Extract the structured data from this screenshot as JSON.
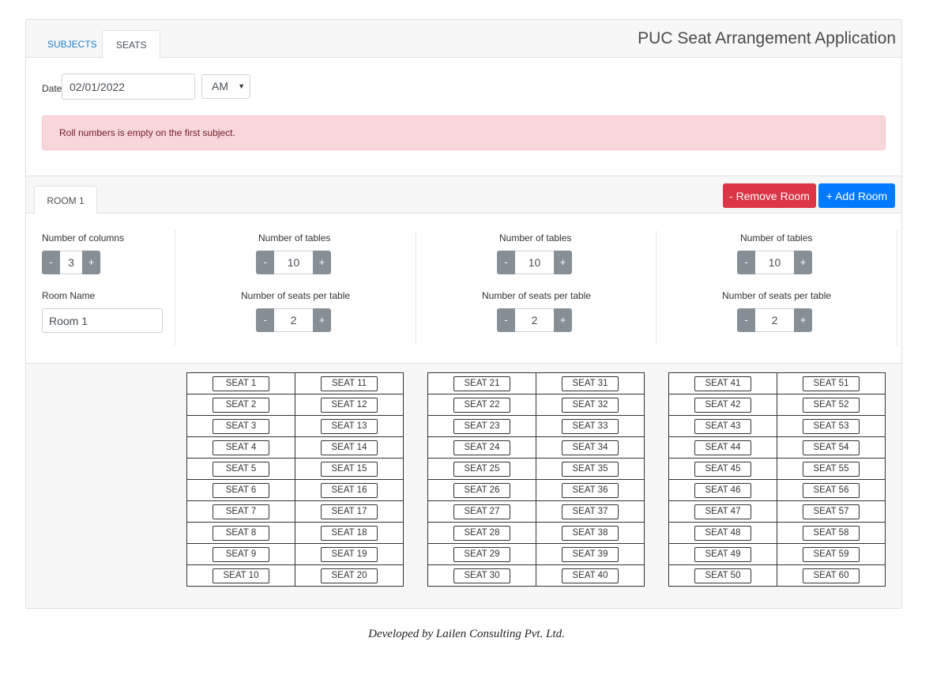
{
  "app": {
    "title": "PUC Seat Arrangement Application"
  },
  "tabs": [
    {
      "label": "SUBJECTS"
    },
    {
      "label": "SEATS"
    }
  ],
  "date": {
    "label": "Date",
    "value": "02/01/2022",
    "period": "AM"
  },
  "alert": {
    "message": "Roll numbers is empty on the first subject."
  },
  "room": {
    "tab_label": "ROOM 1",
    "remove_label": "- Remove Room",
    "add_label": "+ Add Room",
    "columns_label": "Number of columns",
    "columns_value": "3",
    "name_label": "Room Name",
    "name_value": "Room 1",
    "minus": "-",
    "plus": "+",
    "column_settings": [
      {
        "tables_label": "Number of tables",
        "tables_value": "10",
        "seats_label": "Number of seats per table",
        "seats_value": "2"
      },
      {
        "tables_label": "Number of tables",
        "tables_value": "10",
        "seats_label": "Number of seats per table",
        "seats_value": "2"
      },
      {
        "tables_label": "Number of tables",
        "tables_value": "10",
        "seats_label": "Number of seats per table",
        "seats_value": "2"
      }
    ]
  },
  "seats": [
    [
      [
        "SEAT 1",
        "SEAT 11"
      ],
      [
        "SEAT 2",
        "SEAT 12"
      ],
      [
        "SEAT 3",
        "SEAT 13"
      ],
      [
        "SEAT 4",
        "SEAT 14"
      ],
      [
        "SEAT 5",
        "SEAT 15"
      ],
      [
        "SEAT 6",
        "SEAT 16"
      ],
      [
        "SEAT 7",
        "SEAT 17"
      ],
      [
        "SEAT 8",
        "SEAT 18"
      ],
      [
        "SEAT 9",
        "SEAT 19"
      ],
      [
        "SEAT 10",
        "SEAT 20"
      ]
    ],
    [
      [
        "SEAT 21",
        "SEAT 31"
      ],
      [
        "SEAT 22",
        "SEAT 32"
      ],
      [
        "SEAT 23",
        "SEAT 33"
      ],
      [
        "SEAT 24",
        "SEAT 34"
      ],
      [
        "SEAT 25",
        "SEAT 35"
      ],
      [
        "SEAT 26",
        "SEAT 36"
      ],
      [
        "SEAT 27",
        "SEAT 37"
      ],
      [
        "SEAT 28",
        "SEAT 38"
      ],
      [
        "SEAT 29",
        "SEAT 39"
      ],
      [
        "SEAT 30",
        "SEAT 40"
      ]
    ],
    [
      [
        "SEAT 41",
        "SEAT 51"
      ],
      [
        "SEAT 42",
        "SEAT 52"
      ],
      [
        "SEAT 43",
        "SEAT 53"
      ],
      [
        "SEAT 44",
        "SEAT 54"
      ],
      [
        "SEAT 45",
        "SEAT 55"
      ],
      [
        "SEAT 46",
        "SEAT 56"
      ],
      [
        "SEAT 47",
        "SEAT 57"
      ],
      [
        "SEAT 48",
        "SEAT 58"
      ],
      [
        "SEAT 49",
        "SEAT 59"
      ],
      [
        "SEAT 50",
        "SEAT 60"
      ]
    ]
  ],
  "footer": {
    "text": "Developed by Lailen Consulting Pvt. Ltd."
  }
}
